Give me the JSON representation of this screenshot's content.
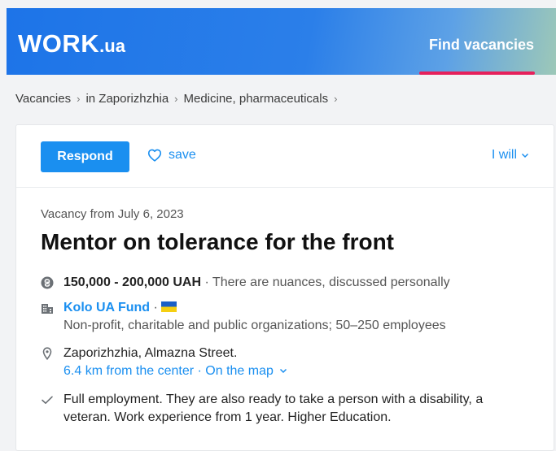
{
  "header": {
    "logo_main": "WORK",
    "logo_suffix": ".ua",
    "nav_label": "Find  vacancies"
  },
  "breadcrumb": {
    "items": [
      "Vacancies",
      "in Zaporizhzhia",
      "Medicine, pharmaceuticals"
    ],
    "separator": "›"
  },
  "toolbar": {
    "respond_label": "Respond",
    "save_label": "save",
    "iwill_label": "I will"
  },
  "vacancy": {
    "date": "Vacancy from July 6, 2023",
    "title": "Mentor on tolerance for the front",
    "salary": "150,000 - 200,000 UAH",
    "salary_note": " · There are nuances, discussed personally",
    "company_name": "Kolo UA Fund",
    "company_sep": " · ",
    "company_desc": "Non-profit, charitable and public organizations; 50–250 employees",
    "address": "Zaporizhzhia, Almazna Street.",
    "distance": "6.4 km from the center",
    "distance_sep": " · ",
    "map_link": "On the map",
    "conditions_line1": "Full employment. They are also ready to take a person with a disability, a",
    "conditions_line2": "veteran. Work experience from 1 year. Higher Education."
  },
  "icons": {
    "salary": "hryvnia-coin-icon",
    "company": "building-icon",
    "address": "location-pin-icon",
    "conditions": "checkmark-icon",
    "save": "heart-icon",
    "flag": "ukraine-flag-icon"
  },
  "colors": {
    "brand_blue": "#1a8ff0",
    "header_blue": "#1d74e8",
    "accent_pink": "#e6205b",
    "flag_blue": "#1a5fc7",
    "flag_yellow": "#f5cf12"
  }
}
